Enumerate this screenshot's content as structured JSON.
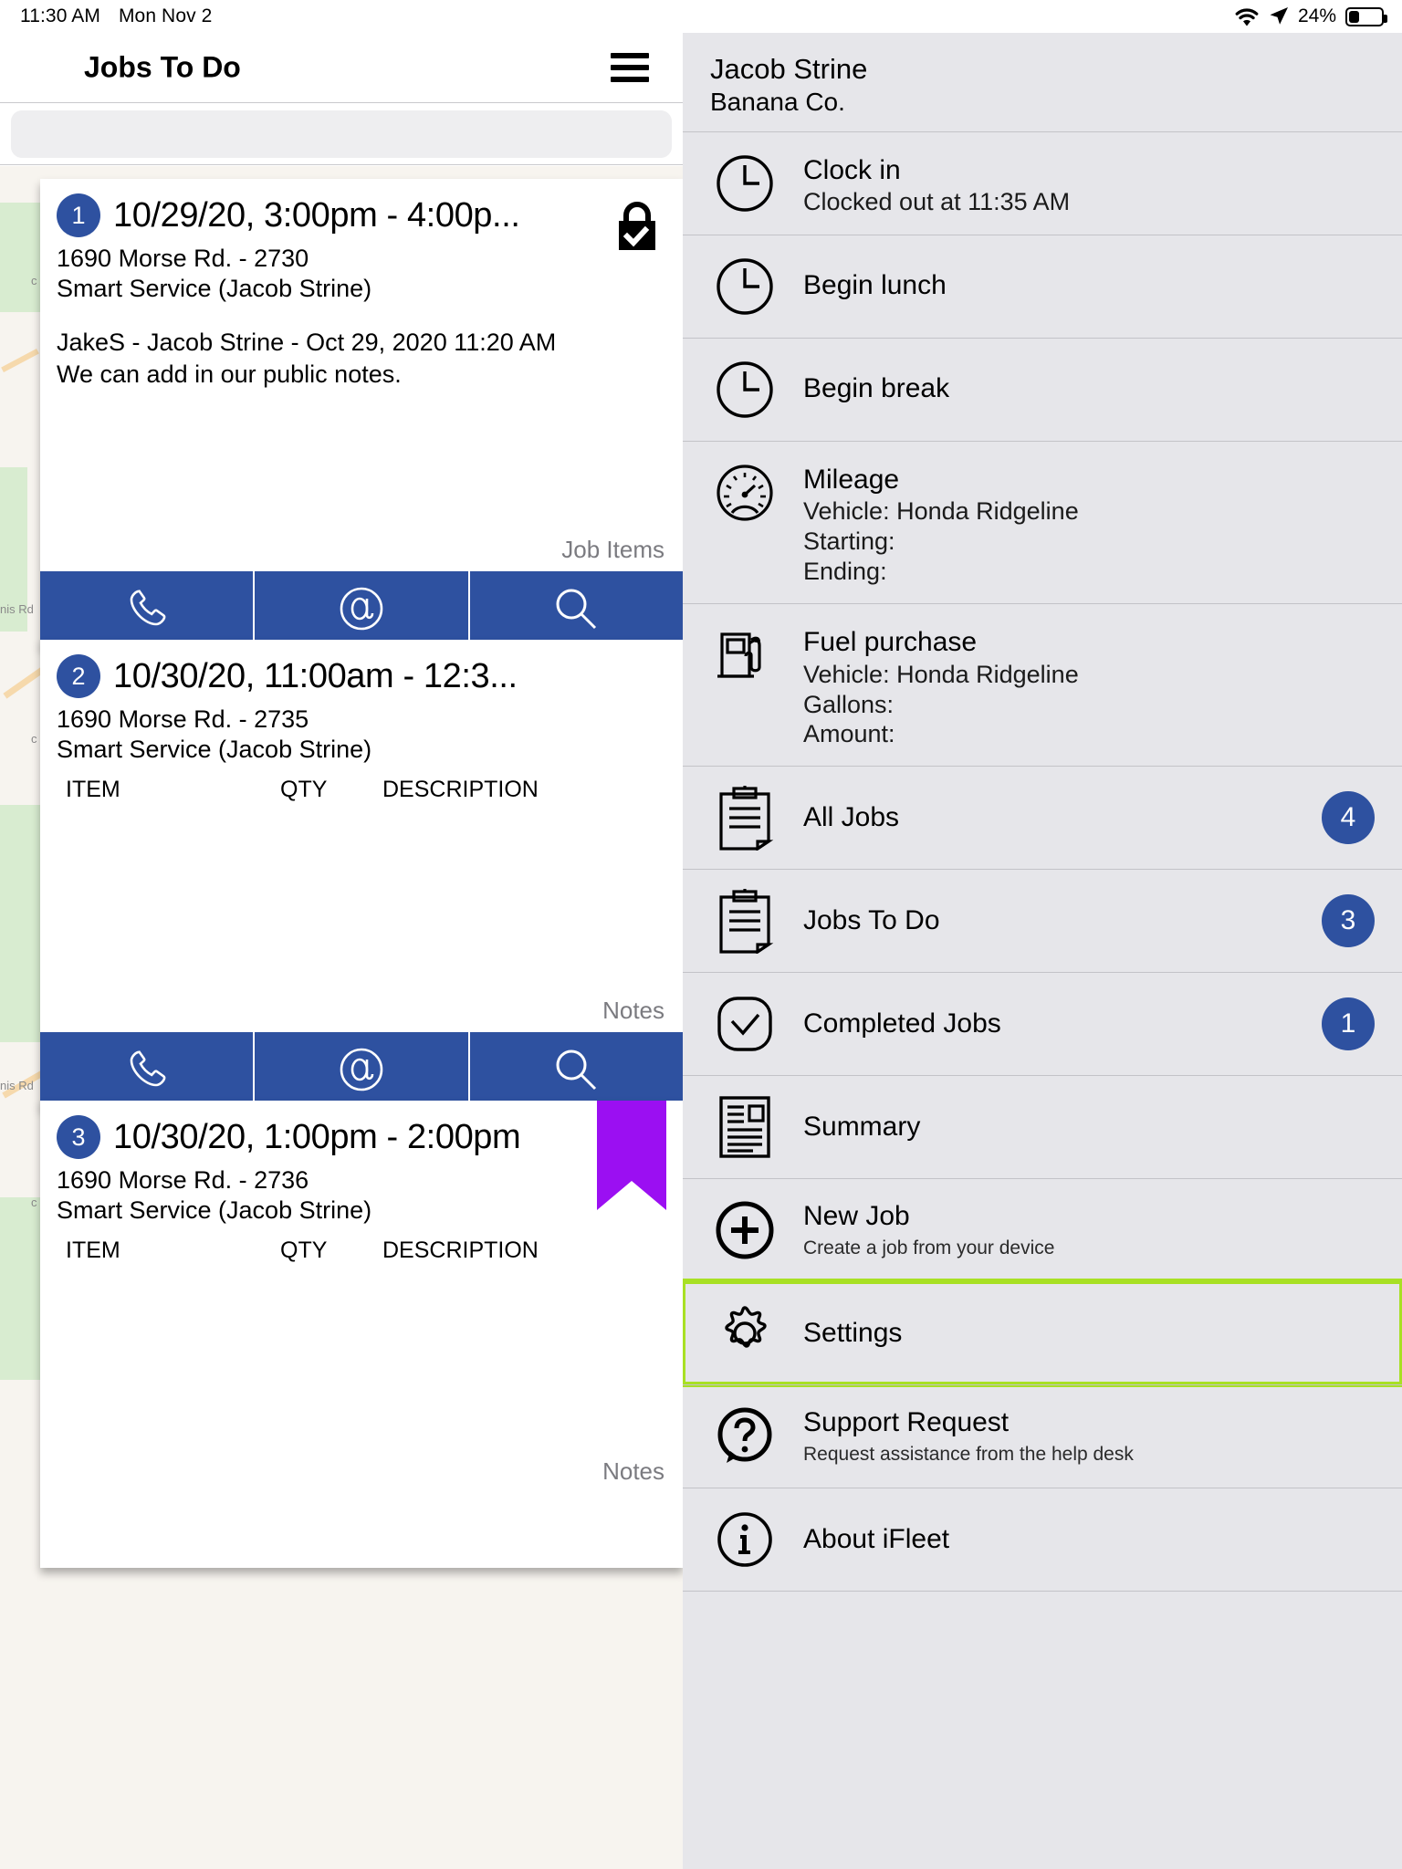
{
  "status_bar": {
    "time": "11:30 AM",
    "date": "Mon Nov 2",
    "battery_percent": "24%",
    "wifi_icon": "wifi-icon",
    "location_icon": "location-arrow-icon",
    "battery_icon": "battery-icon"
  },
  "left_pane": {
    "nav": {
      "title": "Jobs To Do",
      "menu_icon": "hamburger-menu-icon"
    },
    "search": {
      "placeholder": "",
      "value": ""
    },
    "map_labels": [
      "nis Rd",
      "nis Rd"
    ],
    "cards": [
      {
        "seq": "1",
        "time": "10/29/20, 3:00pm - 4:00p...",
        "address": "1690 Morse Rd. - 2730",
        "customer": "Smart Service (Jacob Strine)",
        "note_line_1": "JakeS - Jacob Strine - Oct 29, 2020 11:20 AM",
        "note_line_2": "We can add in our public notes.",
        "foot_label": "Job Items",
        "status_icon": "lock-checked-icon",
        "actions": [
          "phone-icon",
          "email-icon",
          "search-icon"
        ]
      },
      {
        "seq": "2",
        "time": "10/30/20, 11:00am - 12:3...",
        "address": "1690 Morse Rd. - 2735",
        "customer": "Smart Service (Jacob Strine)",
        "columns": [
          "ITEM",
          "QTY",
          "DESCRIPTION"
        ],
        "foot_label": "Notes",
        "actions": [
          "phone-icon",
          "email-icon",
          "search-icon"
        ]
      },
      {
        "seq": "3",
        "time": "10/30/20, 1:00pm - 2:00pm",
        "address": "1690 Morse Rd. - 2736",
        "customer": "Smart Service (Jacob Strine)",
        "columns": [
          "ITEM",
          "QTY",
          "DESCRIPTION"
        ],
        "foot_label": "Notes",
        "status_icon": "flag-icon"
      }
    ]
  },
  "sidebar": {
    "user_name": "Jacob Strine",
    "company": "Banana Co.",
    "items": [
      {
        "icon": "clock-icon",
        "label": "Clock in",
        "sub": "Clocked out at 11:35 AM"
      },
      {
        "icon": "clock-icon",
        "label": "Begin lunch"
      },
      {
        "icon": "clock-icon",
        "label": "Begin break"
      },
      {
        "icon": "speedometer-icon",
        "label": "Mileage",
        "sub1": "Vehicle: Honda Ridgeline",
        "sub2": "Starting:",
        "sub3": "Ending:"
      },
      {
        "icon": "fuel-pump-icon",
        "label": "Fuel purchase",
        "sub1": "Vehicle: Honda Ridgeline",
        "sub2": "Gallons:",
        "sub3": "Amount:"
      },
      {
        "icon": "clipboard-icon",
        "label": "All Jobs",
        "badge": "4"
      },
      {
        "icon": "clipboard-icon",
        "label": "Jobs To Do",
        "badge": "3"
      },
      {
        "icon": "check-circle-icon",
        "label": "Completed Jobs",
        "badge": "1"
      },
      {
        "icon": "document-icon",
        "label": "Summary"
      },
      {
        "icon": "plus-circle-icon",
        "label": "New Job",
        "small": "Create a job from your device"
      },
      {
        "icon": "gear-icon",
        "label": "Settings",
        "highlighted": true
      },
      {
        "icon": "question-circle-icon",
        "label": "Support Request",
        "small": "Request assistance from the help desk"
      },
      {
        "icon": "info-circle-icon",
        "label": "About iFleet"
      }
    ]
  },
  "colors": {
    "accent_blue": "#2e51a0",
    "sidebar_bg": "#e6e6ea",
    "highlight_green": "#a8e024",
    "flag_purple": "#9b0ff2"
  }
}
